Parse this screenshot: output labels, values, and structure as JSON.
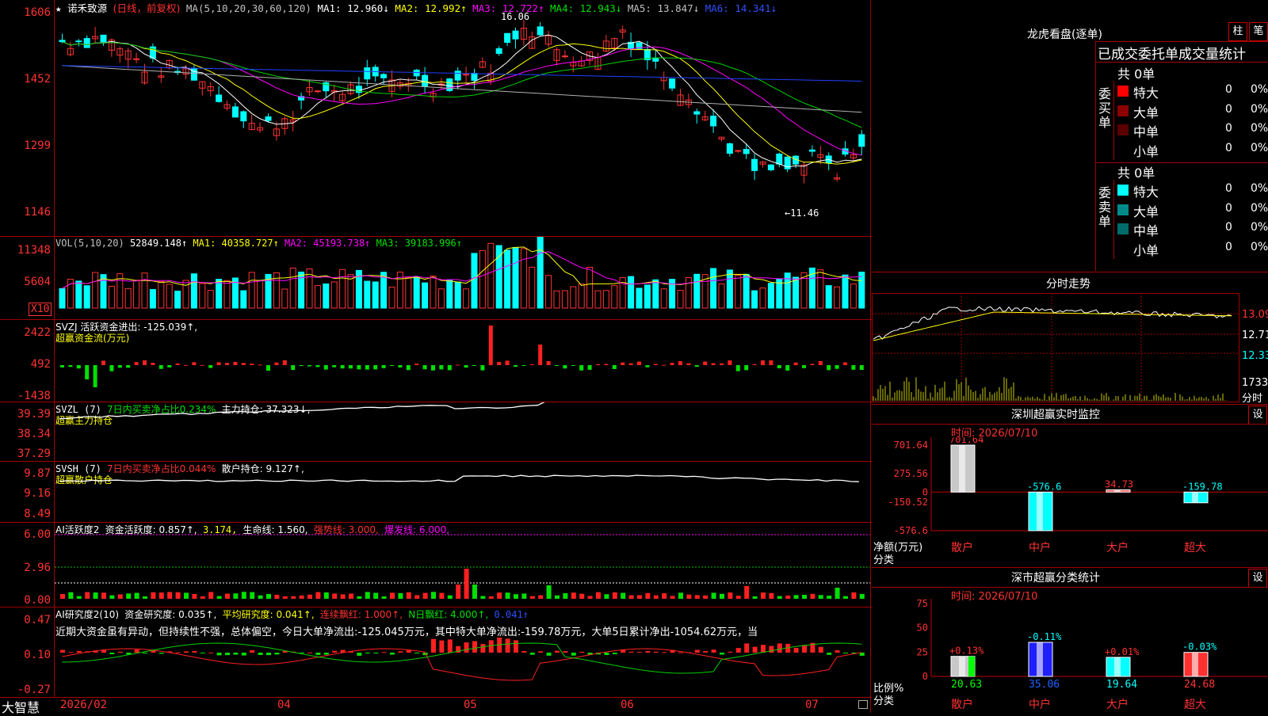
{
  "chart_title": {
    "star": "★",
    "stock": "诺禾致源",
    "period": "(日线，前复权)",
    "ma_label": "MA(5,10,20,30,60,120)",
    "ma1": "MA1: 12.960↓",
    "ma2": "MA2: 12.992↑",
    "ma3": "MA3: 12.722↑",
    "ma4": "MA4: 12.943↓",
    "ma5": "MA5: 13.847↓",
    "ma6": "MA6: 14.341↓"
  },
  "price_axis": [
    "1606",
    "1452",
    "1299",
    "1146"
  ],
  "price_marks": {
    "high": "16.06",
    "low": "←11.46"
  },
  "vol": {
    "label": "VOL(5,10,20)",
    "v": "52849.148↑",
    "ma1": "MA1: 40358.727↑",
    "ma2": "MA2: 45193.738↑",
    "ma3": "MA3: 39183.996↑",
    "axis": [
      "11348",
      "5604"
    ],
    "unit": "X10"
  },
  "svzj": {
    "label": "SVZJ  活跃资金进出: -125.039↑,",
    "sub": "超赢资金流(万元)",
    "axis": [
      "2422",
      "492",
      "-1438"
    ]
  },
  "svzl": {
    "label": "SVZL (7)",
    "ratio": "7日内买卖净占比0.234%",
    "hold": "主力持仓: 37.323↓,",
    "sub": "超赢主力持仓",
    "axis": [
      "39.39",
      "38.34",
      "37.29"
    ]
  },
  "svsh": {
    "label": "SVSH (7)",
    "ratio": "7日内买卖净占比0.044%",
    "hold": "散户持仓: 9.127↑,",
    "sub": "超赢散户持仓",
    "axis": [
      "9.87",
      "9.16",
      "8.49"
    ]
  },
  "ai_active": {
    "label": "AI活跃度2",
    "a": "资金活跃度: 0.857↑,",
    "b": "3.174,",
    "c": "生命线: 1.560,",
    "d": "强势线: 3.000,",
    "e": "爆发线: 6.000,",
    "axis": [
      "6.00",
      "2.96",
      "0.00"
    ]
  },
  "ai_research": {
    "label": "AI研究度2(10)",
    "a": "资金研究度: 0.035↑,",
    "b": "平均研究度: 0.041↑,",
    "c": "连续飘红: 1.000↑,",
    "d": "N日飘红: 4.000↑,",
    "e": "0.041↑",
    "comment": "近期大资金虽有异动，但持续性不强，总体偏空，今日大单净流出:-125.045万元，其中特大单净流出:-159.78万元，大单5日累计净出-1054.62万元，当",
    "axis": [
      "0.47",
      "0.10",
      "-0.27"
    ]
  },
  "date_axis": [
    "2026/02",
    "04",
    "05",
    "06",
    "07"
  ],
  "brand": "大智慧",
  "right": {
    "dragon_title": "龙虎看盘(逐单)",
    "btn_zhu": "柱",
    "btn_bi": "笔",
    "tabs": "已成交委托单成交量统计",
    "buy_total": "共 0单",
    "buy_side": "委买单",
    "sell_total": "共 0单",
    "sell_side": "委卖单",
    "rows": [
      {
        "name": "特大",
        "count": "0",
        "pct": "0%"
      },
      {
        "name": "大单",
        "count": "0",
        "pct": "0%"
      },
      {
        "name": "中单",
        "count": "0",
        "pct": "0%"
      },
      {
        "name": "小单",
        "count": "0",
        "pct": "0%"
      }
    ],
    "buy_colors": [
      "#ff0000",
      "#8b0000",
      "#5a0000",
      "#000000"
    ],
    "sell_colors": [
      "#00ffff",
      "#008b8b",
      "#006b6b",
      "#000000"
    ],
    "intraday_title": "分时走势",
    "intraday_axis": [
      "13.09",
      "12.71",
      "12.33"
    ],
    "intraday_vol": "1733",
    "intraday_unit": "分时",
    "sz_title": "深圳超赢实时监控",
    "sz_set": "设",
    "sz_time": "时间: 2026/07/10",
    "sz_axis": [
      "701.64",
      "275.56",
      "0",
      "-150.52",
      "-576.6"
    ],
    "sz_ylabel": "净额(万元)",
    "sz_xlabel": "分类",
    "sz_values": [
      "701.64",
      "-576.6",
      "34.73",
      "-159.78"
    ],
    "sz_cats": [
      "散户",
      "中户",
      "大户",
      "超大"
    ],
    "cls_title": "深市超赢分类统计",
    "cls_set": "设",
    "cls_time": "时间: 2026/07/10",
    "cls_axis": [
      "75",
      "50",
      "25",
      "0"
    ],
    "cls_ylabel": "比例%",
    "cls_xlabel": "分类",
    "cls_changes": [
      "+0.13%",
      "-0.11%",
      "+0.01%",
      "-0.03%"
    ],
    "cls_values": [
      "20.63",
      "35.06",
      "19.64",
      "24.68"
    ],
    "cls_cats": [
      "散户",
      "中户",
      "大户",
      "超大"
    ]
  },
  "chart_data": [
    {
      "type": "bar",
      "title": "深圳超赢实时监控",
      "ylabel": "净额(万元)",
      "categories": [
        "散户",
        "中户",
        "大户",
        "超大"
      ],
      "values": [
        701.64,
        -576.6,
        34.73,
        -159.78
      ],
      "ylim": [
        -576.6,
        701.64
      ]
    },
    {
      "type": "bar",
      "title": "深市超赢分类统计",
      "ylabel": "比例%",
      "categories": [
        "散户",
        "中户",
        "大户",
        "超大"
      ],
      "values": [
        20.63,
        35.06,
        19.64,
        24.68
      ],
      "ylim": [
        0,
        75
      ]
    }
  ]
}
